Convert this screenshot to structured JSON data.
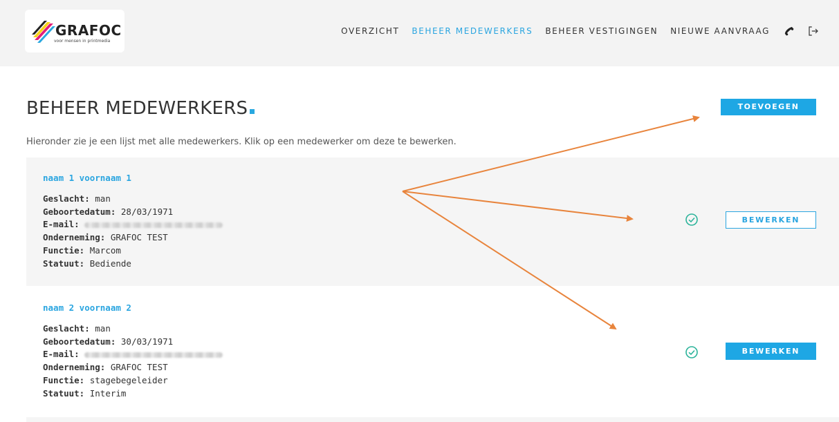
{
  "brand": {
    "name": "GRAFOC",
    "tagline": "voor mensen in printmedia",
    "colors": {
      "accent": "#2aa5e0",
      "magenta": "#e21e79",
      "yellow": "#f7d417",
      "cyan": "#29a8e0",
      "annotation": "#e8843c"
    }
  },
  "nav": {
    "items": [
      {
        "label": "OVERZICHT",
        "active": false
      },
      {
        "label": "BEHEER MEDEWERKERS",
        "active": true
      },
      {
        "label": "BEHEER VESTIGINGEN",
        "active": false
      },
      {
        "label": "NIEUWE AANVRAAG",
        "active": false
      }
    ],
    "icons": [
      "phone-icon",
      "logout-icon"
    ]
  },
  "page": {
    "title": "BEHEER MEDEWERKERS",
    "intro": "Hieronder zie je een lijst met alle medewerkers. Klik op een medewerker om deze te bewerken.",
    "add_button": "TOEVOEGEN"
  },
  "employees": [
    {
      "name": "naam 1 voornaam 1",
      "fields": [
        {
          "key": "Geslacht:",
          "value": "man"
        },
        {
          "key": "Geboortedatum:",
          "value": "28/03/1971"
        },
        {
          "key": "E-mail:",
          "value": ""
        },
        {
          "key": "Onderneming:",
          "value": "GRAFOC TEST"
        },
        {
          "key": "Functie:",
          "value": "Marcom"
        },
        {
          "key": "Statuut:",
          "value": "Bediende"
        }
      ],
      "status_icon": "check-circle-icon",
      "edit_button": "BEWERKEN"
    },
    {
      "name": "naam 2 voornaam 2",
      "fields": [
        {
          "key": "Geslacht:",
          "value": "man"
        },
        {
          "key": "Geboortedatum:",
          "value": "30/03/1971"
        },
        {
          "key": "E-mail:",
          "value": ""
        },
        {
          "key": "Onderneming:",
          "value": "GRAFOC TEST"
        },
        {
          "key": "Functie:",
          "value": "stagebegeleider"
        },
        {
          "key": "Statuut:",
          "value": "Interim"
        }
      ],
      "status_icon": "check-circle-icon",
      "edit_button": "BEWERKEN"
    }
  ]
}
